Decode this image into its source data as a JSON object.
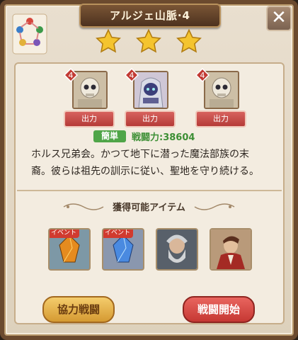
{
  "dialog": {
    "title": "アルジェ山脈·4",
    "close_icon": "close-x-icon"
  },
  "stage": {
    "stars_earned": 3,
    "stars_total": 3,
    "difficulty": "簡単",
    "power_label": "戦闘力:38604",
    "description_lines": [
      "ホルス兄弟会。かつて地下に潜った魔法部族の末",
      "裔。彼らは祖先の訓示に従い、聖地を守り続ける。"
    ]
  },
  "enemies": [
    {
      "level": "4",
      "button": "出力",
      "icon": "skeleton-knight-portrait"
    },
    {
      "level": "4",
      "button": "出力",
      "icon": "hooded-mage-portrait"
    },
    {
      "level": "4",
      "button": "出力",
      "icon": "skeleton-knight-portrait"
    }
  ],
  "rewards": {
    "title": "獲得可能アイテム",
    "items": [
      {
        "tag": "イベント",
        "icon": "amber-crystal-icon"
      },
      {
        "tag": "イベント",
        "icon": "blue-crystal-icon"
      },
      {
        "tag": "",
        "icon": "old-bearded-hero-portrait"
      },
      {
        "tag": "",
        "icon": "red-coat-hero-portrait"
      }
    ]
  },
  "actions": {
    "coop_label": "協力戦闘",
    "start_label": "戦闘開始"
  },
  "colors": {
    "frame": "#6b4a2e",
    "panel": "#f3ece0",
    "accent_red": "#c53833",
    "accent_gold": "#d59a32",
    "difficulty_green": "#4fa548"
  }
}
